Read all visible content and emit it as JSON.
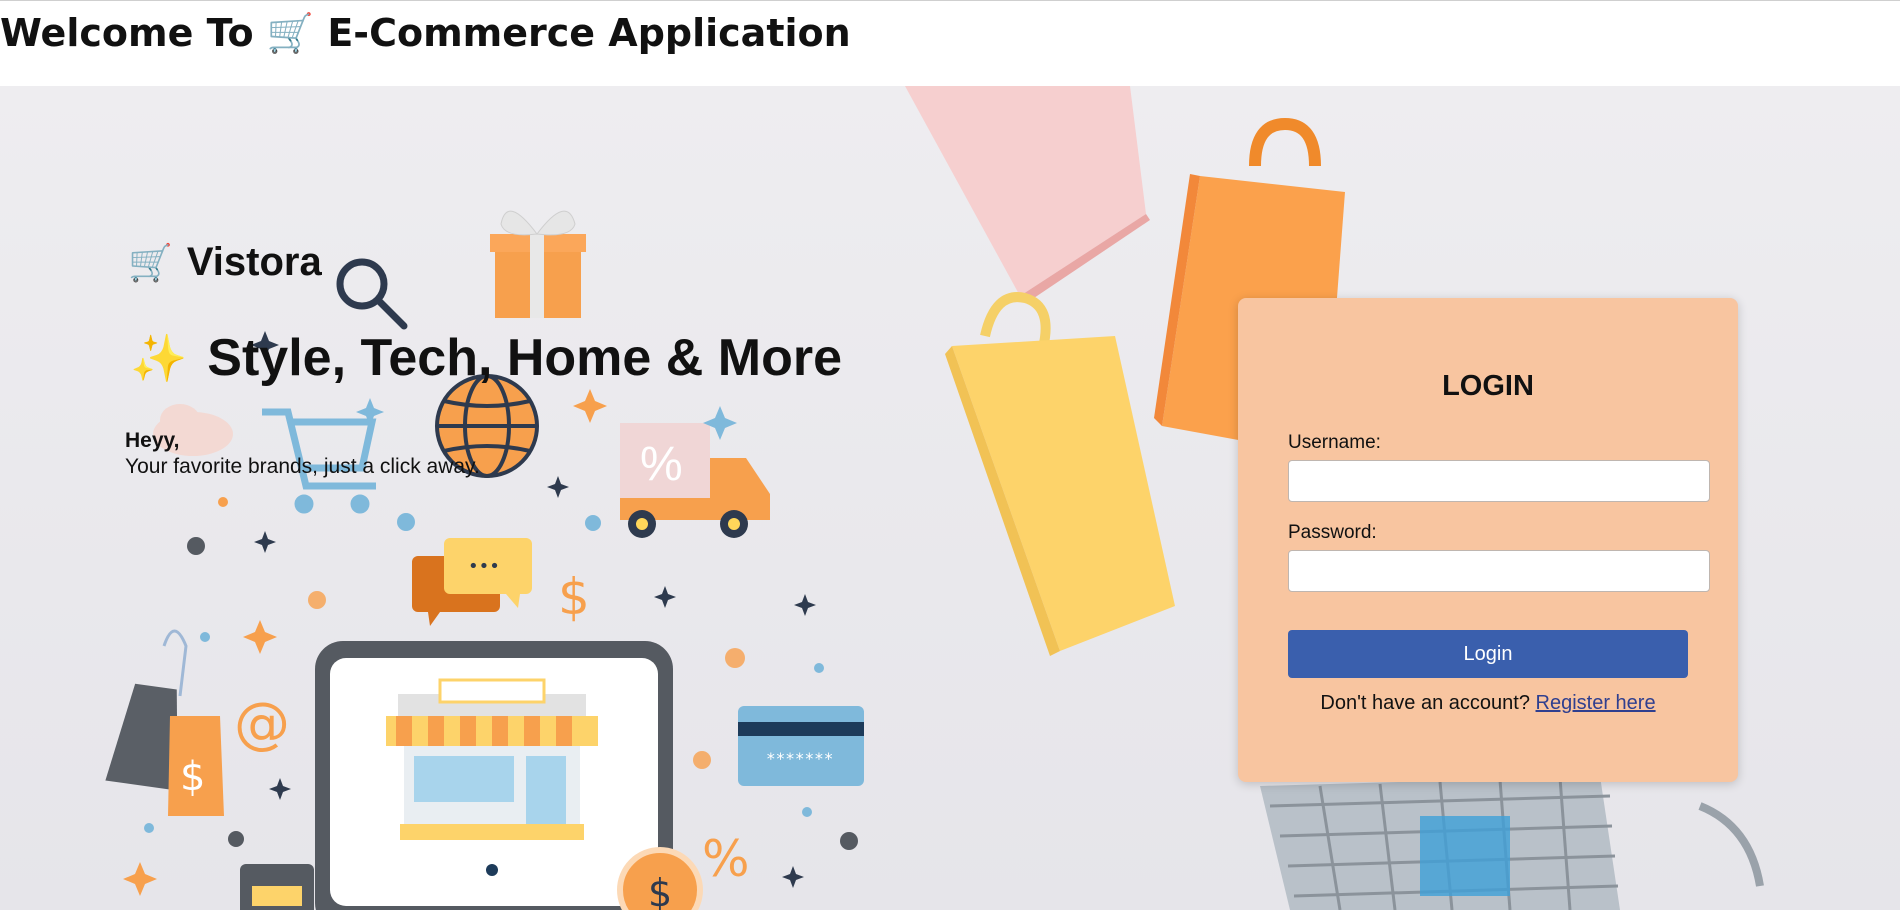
{
  "header": {
    "title": "Welcome To 🛒 E-Commerce Application"
  },
  "hero": {
    "brand_icon": "🛒",
    "brand_name": "Vistora",
    "tagline_icon": "✨",
    "tagline": "Style, Tech, Home & More",
    "greeting_title": "Heyy,",
    "greeting_text": "Your favorite brands, just a click away."
  },
  "illustration": {
    "card_number_mask": "*******",
    "percent_sign": "%",
    "dollar_sign": "$",
    "at_sign": "@",
    "chat_dots": "•••",
    "icons": [
      "magnifier-icon",
      "gift-icon",
      "globe-icon",
      "shopping-cart-icon",
      "delivery-truck-icon",
      "chat-bubble-icon",
      "price-tag-icon",
      "credit-card-icon",
      "computer-storefront-icon",
      "calculator-icon",
      "coin-icon",
      "cloud-icon"
    ]
  },
  "login": {
    "title": "LOGIN",
    "username_label": "Username:",
    "username_value": "",
    "password_label": "Password:",
    "password_value": "",
    "button_label": "Login",
    "register_prompt": "Don't have an account?",
    "register_link": "Register here"
  },
  "colors": {
    "card_bg": "#f8c5a0",
    "button_bg": "#3a5fad",
    "link": "#2f3f8f",
    "accent_orange": "#f7a04d",
    "accent_yellow": "#fdd36a",
    "accent_blue": "#7fb9db"
  }
}
